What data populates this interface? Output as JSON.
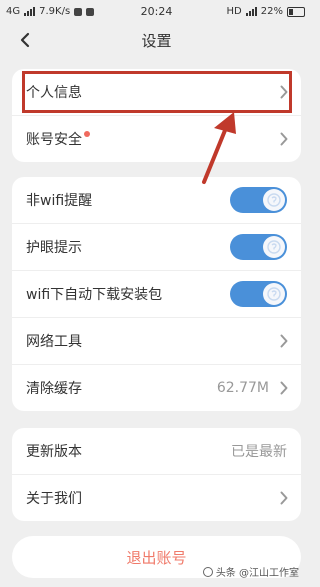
{
  "status_bar": {
    "network": "4G",
    "speed": "7.9K/s",
    "time": "20:24",
    "hd": "HD",
    "battery_pct": "22%"
  },
  "nav": {
    "back_icon": "chevron-left-icon",
    "title": "设置"
  },
  "section1": {
    "profile_label": "个人信息",
    "account_security_label": "账号安全",
    "account_security_dot_color": "#f06a5e"
  },
  "section2": {
    "nonwifi_reminder_label": "非wifi提醒",
    "nonwifi_reminder_on": true,
    "eye_care_label": "护眼提示",
    "eye_care_on": true,
    "wifi_download_label": "wifi下自动下载安装包",
    "wifi_download_on": true,
    "network_tools_label": "网络工具",
    "clear_cache_label": "清除缓存",
    "clear_cache_value": "62.77M"
  },
  "section3": {
    "update_label": "更新版本",
    "update_value": "已是最新",
    "about_label": "关于我们"
  },
  "logout": {
    "label": "退出账号",
    "color": "#f07a6a"
  },
  "annotation": {
    "highlight_color": "#c0392b"
  },
  "watermark": {
    "text": "头条 @江山工作室"
  },
  "accent_color": "#4a90d9"
}
